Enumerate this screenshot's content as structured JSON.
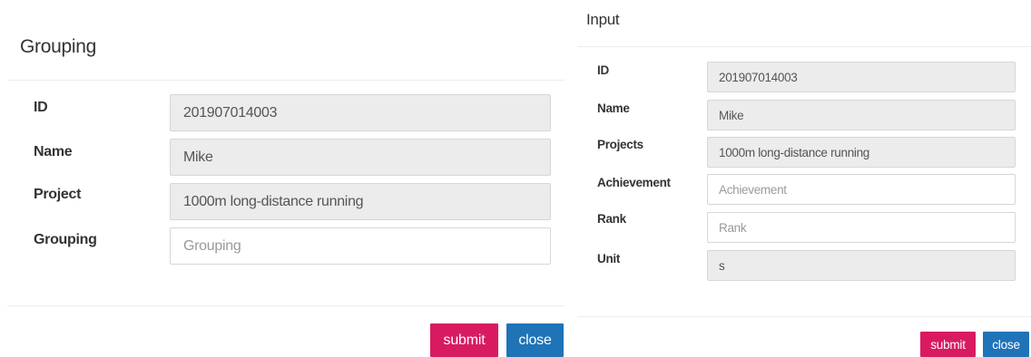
{
  "grouping_dialog": {
    "title": "Grouping",
    "fields": [
      {
        "label": "ID",
        "value": "201907014003",
        "placeholder": ""
      },
      {
        "label": "Name",
        "value": "Mike",
        "placeholder": ""
      },
      {
        "label": "Project",
        "value": "1000m long-distance running",
        "placeholder": ""
      },
      {
        "label": "Grouping",
        "value": "",
        "placeholder": "Grouping"
      }
    ],
    "submit_label": "submit",
    "close_label": "close"
  },
  "input_dialog": {
    "title": "Input",
    "fields": [
      {
        "label": "ID",
        "value": "201907014003",
        "placeholder": ""
      },
      {
        "label": "Name",
        "value": "Mike",
        "placeholder": ""
      },
      {
        "label": "Projects",
        "value": "1000m long-distance running",
        "placeholder": ""
      },
      {
        "label": "Achievement",
        "value": "",
        "placeholder": "Achievement"
      },
      {
        "label": "Rank",
        "value": "",
        "placeholder": "Rank"
      },
      {
        "label": "Unit",
        "value": "s",
        "placeholder": ""
      }
    ],
    "submit_label": "submit",
    "close_label": "close"
  },
  "colors": {
    "submit_button": "#d81b60",
    "close_button": "#1f73b7",
    "readonly_field": "#ececec"
  }
}
